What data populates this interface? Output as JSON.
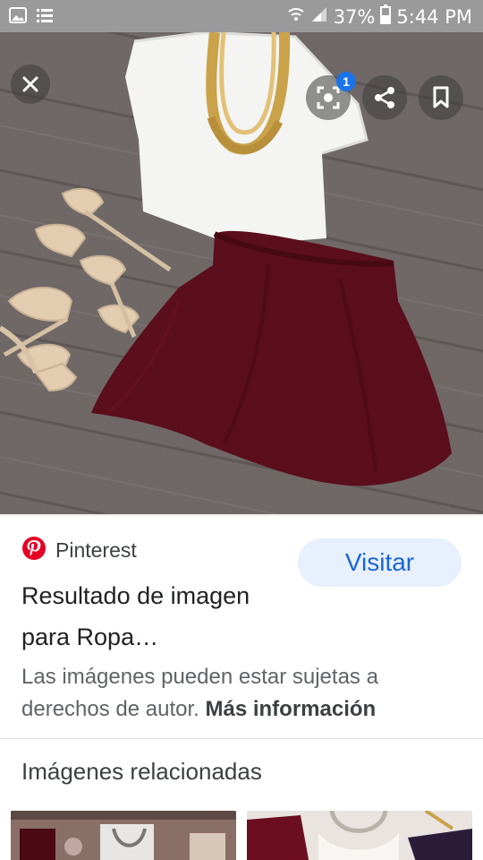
{
  "status_bar": {
    "battery": "37%",
    "time": "5:44 PM"
  },
  "viewer": {
    "lens_badge": "1",
    "close_icon": "close-icon",
    "lens_icon": "lens-icon",
    "share_icon": "share-icon",
    "save_icon": "bookmark-icon"
  },
  "result": {
    "source": "Pinterest",
    "visit_label": "Visitar",
    "title": "Resultado de imagen para Ropa…",
    "copyright_text": "Las imágenes pueden estar sujetas a derechos de autor.",
    "more_info": "Más información"
  },
  "related": {
    "title": "Imágenes relacionadas"
  },
  "colors": {
    "accent": "#1967d2",
    "visit_bg": "#e8f0fe",
    "pinterest_red": "#e60023",
    "skirt": "#5e0f1c",
    "floor": "#6e6766"
  }
}
